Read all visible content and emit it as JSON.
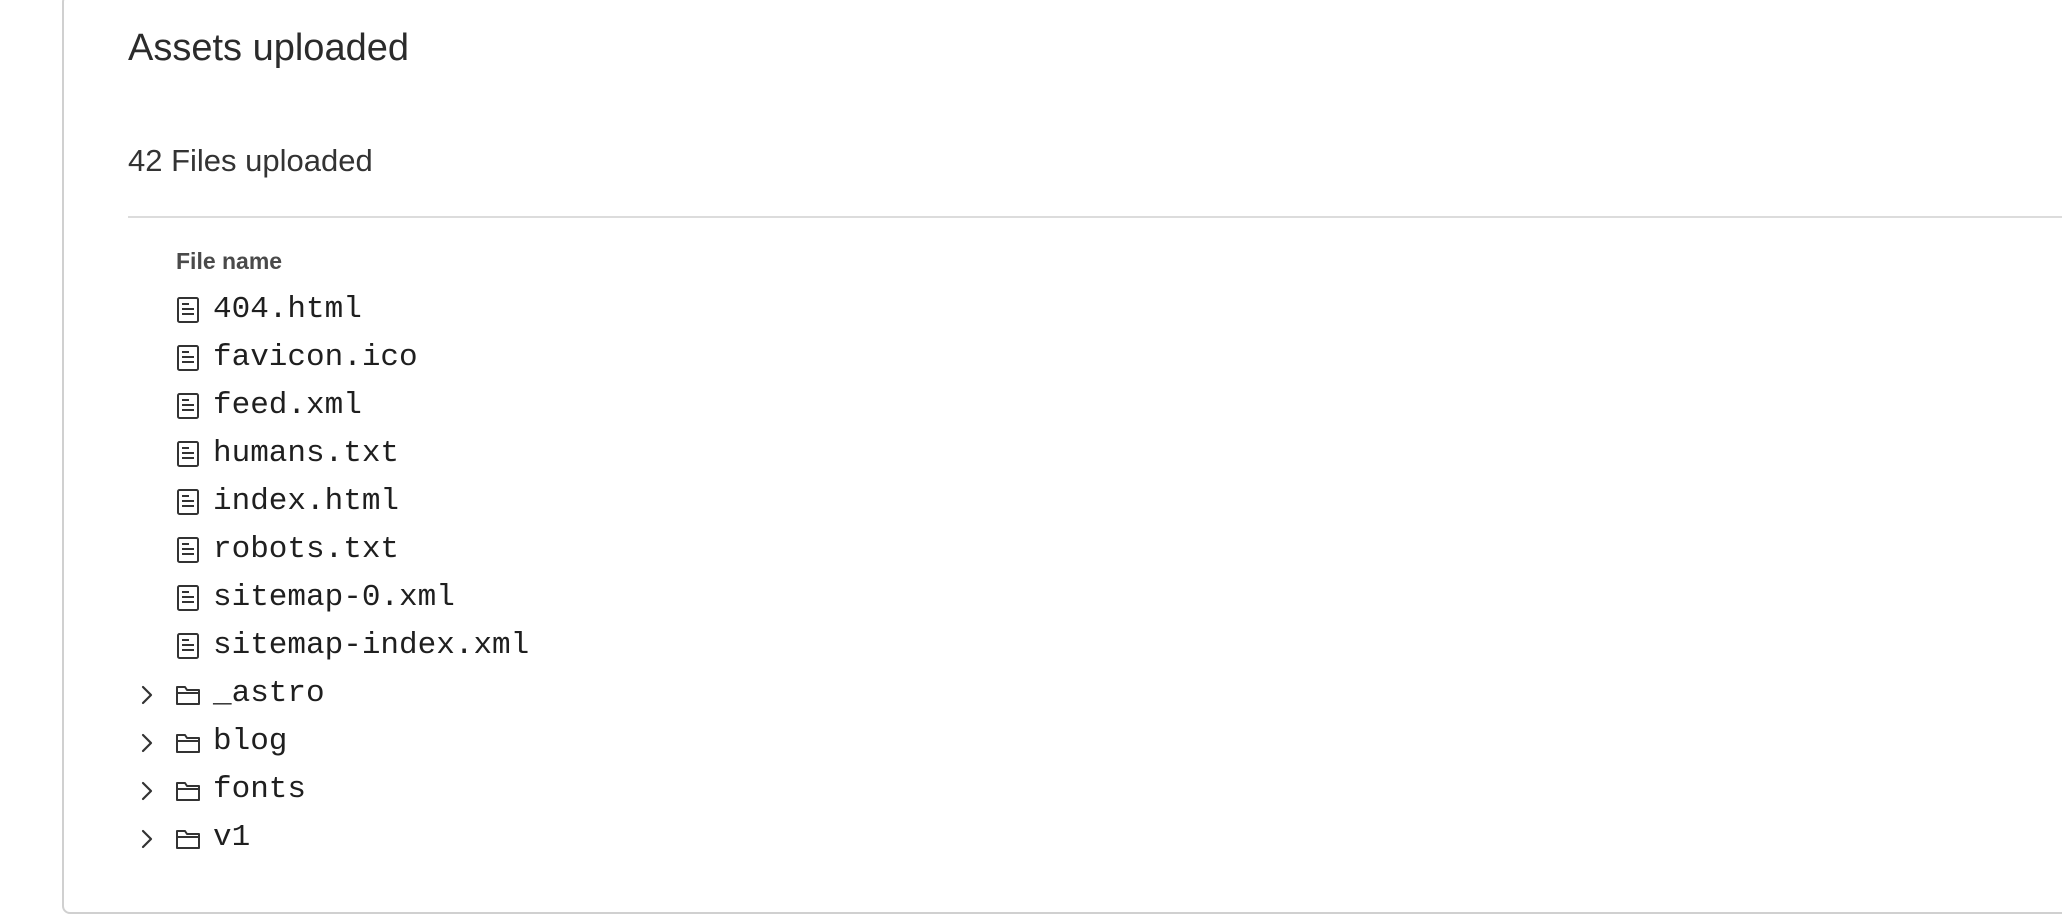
{
  "section": {
    "title": "Assets uploaded",
    "file_count_label": "42 Files uploaded",
    "column_header": "File name"
  },
  "files": [
    {
      "name": "404.html",
      "kind": "file",
      "icon": "file-icon"
    },
    {
      "name": "favicon.ico",
      "kind": "file",
      "icon": "file-icon"
    },
    {
      "name": "feed.xml",
      "kind": "file",
      "icon": "file-icon"
    },
    {
      "name": "humans.txt",
      "kind": "file",
      "icon": "file-icon"
    },
    {
      "name": "index.html",
      "kind": "file",
      "icon": "file-icon"
    },
    {
      "name": "robots.txt",
      "kind": "file",
      "icon": "file-icon"
    },
    {
      "name": "sitemap-0.xml",
      "kind": "file",
      "icon": "file-icon"
    },
    {
      "name": "sitemap-index.xml",
      "kind": "file",
      "icon": "file-icon"
    }
  ],
  "folders": [
    {
      "name": "_astro",
      "kind": "folder",
      "icon": "folder-icon",
      "expanded": false
    },
    {
      "name": "blog",
      "kind": "folder",
      "icon": "folder-icon",
      "expanded": false
    },
    {
      "name": "fonts",
      "kind": "folder",
      "icon": "folder-icon",
      "expanded": false
    },
    {
      "name": "v1",
      "kind": "folder",
      "icon": "folder-icon",
      "expanded": false
    }
  ],
  "colors": {
    "text": "#1f1f1f",
    "border": "#d0d0d0",
    "divider": "#dcdcdc",
    "icon": "#333333"
  }
}
